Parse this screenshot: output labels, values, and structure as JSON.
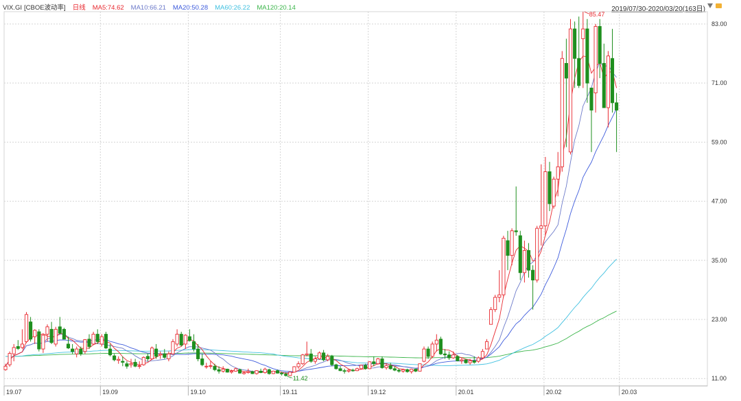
{
  "header": {
    "symbol": "VIX.GI",
    "name": "[CBOE波动率]",
    "period": "日线",
    "ma_labels": [
      {
        "label": "MA5:74.62",
        "color": "#e8292f"
      },
      {
        "label": "MA10:66.21",
        "color": "#6b79c9"
      },
      {
        "label": "MA20:50.28",
        "color": "#3d5bdc"
      },
      {
        "label": "MA60:26.22",
        "color": "#40c0e0"
      },
      {
        "label": "MA120:20.14",
        "color": "#3bb54a"
      }
    ],
    "range": "2019/07/30-2020/03/20(163日)"
  },
  "chart_data": {
    "type": "candlestick",
    "y_ticks": [
      "83.00",
      "71.00",
      "59.00",
      "47.00",
      "35.00",
      "23.00",
      "11.00"
    ],
    "ylim": [
      9.5,
      85.5
    ],
    "x_ticks": [
      {
        "label": "19.07",
        "i": 0
      },
      {
        "label": "19.09",
        "i": 23
      },
      {
        "label": "19.10",
        "i": 44
      },
      {
        "label": "19.11",
        "i": 66
      },
      {
        "label": "19.12",
        "i": 87
      },
      {
        "label": "20.01",
        "i": 108
      },
      {
        "label": "20.02",
        "i": 129
      },
      {
        "label": "20.03",
        "i": 147
      }
    ],
    "grid": true,
    "annotations": [
      {
        "label": "85.47",
        "type": "max"
      },
      {
        "label": "11.42",
        "type": "min"
      }
    ],
    "colors": {
      "up": "#e8292f",
      "down": "#1f8f1f",
      "ma5": "#e8292f",
      "ma10": "#6b79c9",
      "ma20": "#3d5bdc",
      "ma60": "#40c0e0",
      "ma120": "#3bb54a",
      "grid": "#d4d4d4"
    },
    "candles": [
      [
        12.8,
        14.0,
        12.6,
        13.5
      ],
      [
        13.8,
        16.5,
        13.4,
        16.1
      ],
      [
        16.0,
        18.0,
        14.5,
        17.3
      ],
      [
        17.5,
        18.8,
        16.8,
        17.1
      ],
      [
        17.3,
        21.0,
        17.0,
        18.0
      ],
      [
        18.5,
        24.5,
        18.2,
        24.0
      ],
      [
        22.5,
        23.5,
        18.5,
        19.0
      ],
      [
        19.5,
        21.0,
        18.0,
        20.8
      ],
      [
        20.5,
        21.0,
        16.5,
        17.0
      ],
      [
        17.0,
        20.0,
        16.2,
        19.8
      ],
      [
        20.0,
        22.0,
        18.5,
        21.5
      ],
      [
        21.0,
        22.5,
        18.0,
        18.3
      ],
      [
        18.0,
        21.5,
        17.5,
        21.0
      ],
      [
        21.5,
        23.5,
        20.0,
        20.2
      ],
      [
        21.0,
        21.3,
        19.0,
        19.0
      ],
      [
        18.0,
        19.5,
        17.0,
        17.2
      ],
      [
        17.0,
        18.0,
        16.0,
        16.5
      ],
      [
        16.0,
        17.5,
        15.3,
        17.0
      ],
      [
        17.0,
        17.5,
        15.6,
        16.0
      ],
      [
        16.5,
        19.0,
        16.0,
        18.9
      ],
      [
        19.0,
        20.0,
        17.0,
        17.5
      ],
      [
        18.0,
        20.5,
        17.8,
        20.0
      ],
      [
        20.0,
        21.0,
        18.0,
        18.5
      ],
      [
        18.0,
        20.0,
        17.5,
        19.5
      ],
      [
        20.0,
        20.5,
        17.0,
        17.2
      ],
      [
        17.0,
        18.0,
        15.5,
        15.8
      ],
      [
        15.6,
        16.0,
        14.5,
        14.8
      ],
      [
        14.7,
        15.5,
        14.0,
        14.9
      ],
      [
        14.5,
        15.5,
        13.5,
        14.3
      ],
      [
        14.0,
        14.5,
        13.0,
        13.5
      ],
      [
        13.8,
        15.0,
        13.2,
        14.0
      ],
      [
        14.3,
        15.0,
        13.3,
        13.5
      ],
      [
        13.5,
        14.5,
        13.0,
        13.6
      ],
      [
        13.8,
        15.5,
        13.6,
        15.3
      ],
      [
        15.5,
        16.0,
        14.5,
        15.0
      ],
      [
        15.0,
        17.5,
        14.8,
        17.2
      ],
      [
        17.0,
        18.0,
        15.0,
        15.5
      ],
      [
        15.8,
        16.5,
        15.0,
        16.0
      ],
      [
        16.0,
        17.0,
        15.0,
        15.3
      ],
      [
        15.0,
        16.5,
        14.5,
        16.0
      ],
      [
        16.0,
        19.0,
        15.8,
        18.5
      ],
      [
        18.0,
        21.0,
        17.5,
        20.0
      ],
      [
        20.0,
        20.5,
        17.5,
        17.8
      ],
      [
        18.0,
        20.0,
        17.0,
        19.8
      ],
      [
        19.5,
        21.0,
        18.5,
        18.7
      ],
      [
        18.5,
        20.0,
        16.5,
        17.0
      ],
      [
        17.0,
        18.0,
        14.5,
        15.0
      ],
      [
        15.0,
        16.0,
        13.5,
        13.8
      ],
      [
        13.5,
        14.2,
        13.0,
        13.5
      ],
      [
        13.5,
        14.5,
        13.0,
        13.6
      ],
      [
        13.5,
        14.0,
        12.5,
        12.8
      ],
      [
        12.8,
        13.5,
        12.0,
        12.5
      ],
      [
        12.5,
        13.5,
        12.2,
        12.9
      ],
      [
        12.9,
        13.0,
        12.2,
        12.3
      ],
      [
        12.3,
        12.8,
        12.0,
        12.5
      ],
      [
        12.5,
        13.2,
        12.4,
        13.0
      ],
      [
        12.8,
        13.0,
        12.0,
        12.1
      ],
      [
        12.0,
        12.5,
        11.8,
        12.2
      ],
      [
        12.2,
        13.0,
        12.0,
        12.4
      ],
      [
        12.4,
        12.6,
        11.9,
        12.0
      ],
      [
        12.0,
        12.7,
        11.8,
        12.6
      ],
      [
        12.5,
        13.0,
        12.1,
        12.2
      ],
      [
        12.2,
        13.2,
        12.0,
        12.9
      ],
      [
        12.8,
        13.0,
        11.8,
        12.0
      ],
      [
        12.0,
        12.6,
        11.9,
        12.5
      ],
      [
        12.6,
        12.8,
        12.0,
        12.1
      ],
      [
        12.1,
        12.4,
        11.6,
        12.0
      ],
      [
        11.9,
        12.3,
        11.42,
        11.6
      ],
      [
        11.6,
        12.5,
        11.5,
        12.3
      ],
      [
        12.3,
        13.5,
        12.2,
        13.4
      ],
      [
        13.4,
        14.5,
        13.0,
        14.0
      ],
      [
        14.0,
        16.0,
        13.8,
        15.8
      ],
      [
        15.8,
        18.5,
        15.5,
        16.0
      ],
      [
        16.0,
        17.0,
        14.2,
        14.5
      ],
      [
        14.5,
        15.5,
        14.0,
        15.0
      ],
      [
        15.0,
        16.5,
        14.8,
        16.2
      ],
      [
        16.2,
        16.8,
        14.5,
        14.8
      ],
      [
        14.8,
        16.0,
        14.5,
        15.5
      ],
      [
        15.5,
        15.8,
        13.5,
        13.8
      ],
      [
        13.8,
        14.0,
        12.8,
        13.0
      ],
      [
        13.0,
        13.5,
        12.5,
        12.6
      ],
      [
        12.6,
        13.0,
        12.0,
        12.5
      ],
      [
        12.5,
        13.0,
        12.2,
        12.7
      ],
      [
        12.7,
        13.0,
        12.4,
        12.6
      ],
      [
        12.6,
        13.2,
        12.5,
        13.0
      ],
      [
        13.0,
        13.8,
        12.8,
        13.7
      ],
      [
        13.7,
        14.0,
        12.8,
        13.0
      ],
      [
        13.0,
        14.5,
        12.9,
        14.4
      ],
      [
        14.4,
        15.5,
        13.5,
        14.0
      ],
      [
        14.0,
        15.2,
        13.8,
        15.0
      ],
      [
        15.0,
        15.5,
        13.0,
        13.2
      ],
      [
        13.2,
        14.0,
        12.8,
        13.6
      ],
      [
        13.6,
        14.2,
        12.8,
        13.0
      ],
      [
        13.0,
        13.5,
        12.5,
        12.7
      ],
      [
        12.7,
        13.0,
        12.2,
        12.5
      ],
      [
        12.5,
        13.0,
        12.2,
        12.8
      ],
      [
        12.8,
        13.0,
        12.2,
        12.4
      ],
      [
        12.4,
        13.0,
        12.0,
        12.9
      ],
      [
        12.9,
        13.0,
        12.3,
        12.5
      ],
      [
        12.5,
        14.0,
        12.5,
        14.0
      ],
      [
        14.5,
        17.5,
        14.3,
        17.0
      ],
      [
        17.0,
        17.5,
        15.0,
        15.5
      ],
      [
        15.5,
        18.5,
        15.2,
        18.0
      ],
      [
        18.0,
        20.0,
        16.5,
        18.8
      ],
      [
        19.0,
        19.5,
        15.8,
        16.0
      ],
      [
        16.0,
        17.0,
        15.0,
        15.8
      ],
      [
        15.8,
        16.5,
        14.8,
        15.2
      ],
      [
        15.2,
        16.5,
        15.0,
        15.8
      ],
      [
        15.5,
        15.8,
        14.5,
        14.6
      ],
      [
        14.6,
        15.2,
        14.0,
        14.8
      ],
      [
        14.8,
        15.0,
        14.0,
        14.2
      ],
      [
        14.2,
        15.0,
        13.8,
        14.6
      ],
      [
        14.6,
        15.5,
        14.0,
        14.3
      ],
      [
        14.5,
        15.5,
        14.2,
        15.2
      ],
      [
        15.2,
        17.0,
        15.0,
        16.5
      ],
      [
        17.0,
        19.0,
        17.0,
        18.5
      ],
      [
        22.0,
        25.5,
        22.0,
        25.0
      ],
      [
        25.0,
        28.0,
        24.5,
        27.5
      ],
      [
        27.5,
        33.0,
        26.5,
        28.0
      ],
      [
        28.0,
        40.0,
        27.5,
        39.5
      ],
      [
        39.0,
        41.0,
        33.0,
        36.0
      ],
      [
        36.0,
        41.5,
        34.0,
        41.0
      ],
      [
        41.0,
        50.0,
        40.0,
        40.8
      ],
      [
        40.0,
        41.0,
        31.0,
        32.5
      ],
      [
        32.5,
        39.0,
        30.5,
        37.0
      ],
      [
        37.0,
        38.5,
        31.5,
        33.0
      ],
      [
        33.0,
        34.0,
        25.0,
        31.0
      ],
      [
        31.0,
        42.0,
        30.5,
        41.5
      ],
      [
        41.5,
        54.5,
        38.0,
        42.0
      ],
      [
        42.0,
        56.0,
        40.0,
        53.0
      ],
      [
        53.0,
        55.0,
        45.0,
        46.5
      ],
      [
        46.0,
        52.0,
        45.5,
        51.5
      ],
      [
        51.5,
        57.0,
        48.0,
        54.0
      ],
      [
        54.0,
        77.5,
        53.0,
        76.0
      ],
      [
        75.0,
        80.0,
        58.0,
        72.0
      ],
      [
        57.0,
        84.0,
        56.5,
        82.0
      ],
      [
        82.0,
        83.5,
        70.0,
        76.0
      ],
      [
        76.0,
        84.5,
        70.0,
        70.5
      ],
      [
        80.0,
        85.47,
        70.0,
        82.0
      ],
      [
        82.0,
        84.0,
        67.0,
        71.0
      ],
      [
        70.0,
        70.0,
        57.0,
        65.5
      ],
      [
        69.0,
        83.0,
        65.0,
        82.5
      ],
      [
        82.5,
        84.0,
        72.0,
        75.0
      ],
      [
        75.0,
        79.0,
        66.0,
        66.0
      ],
      [
        66.0,
        77.5,
        62.0,
        76.5
      ],
      [
        76.0,
        82.0,
        65.0,
        67.0
      ],
      [
        67.0,
        69.0,
        57.0,
        65.5
      ]
    ]
  }
}
